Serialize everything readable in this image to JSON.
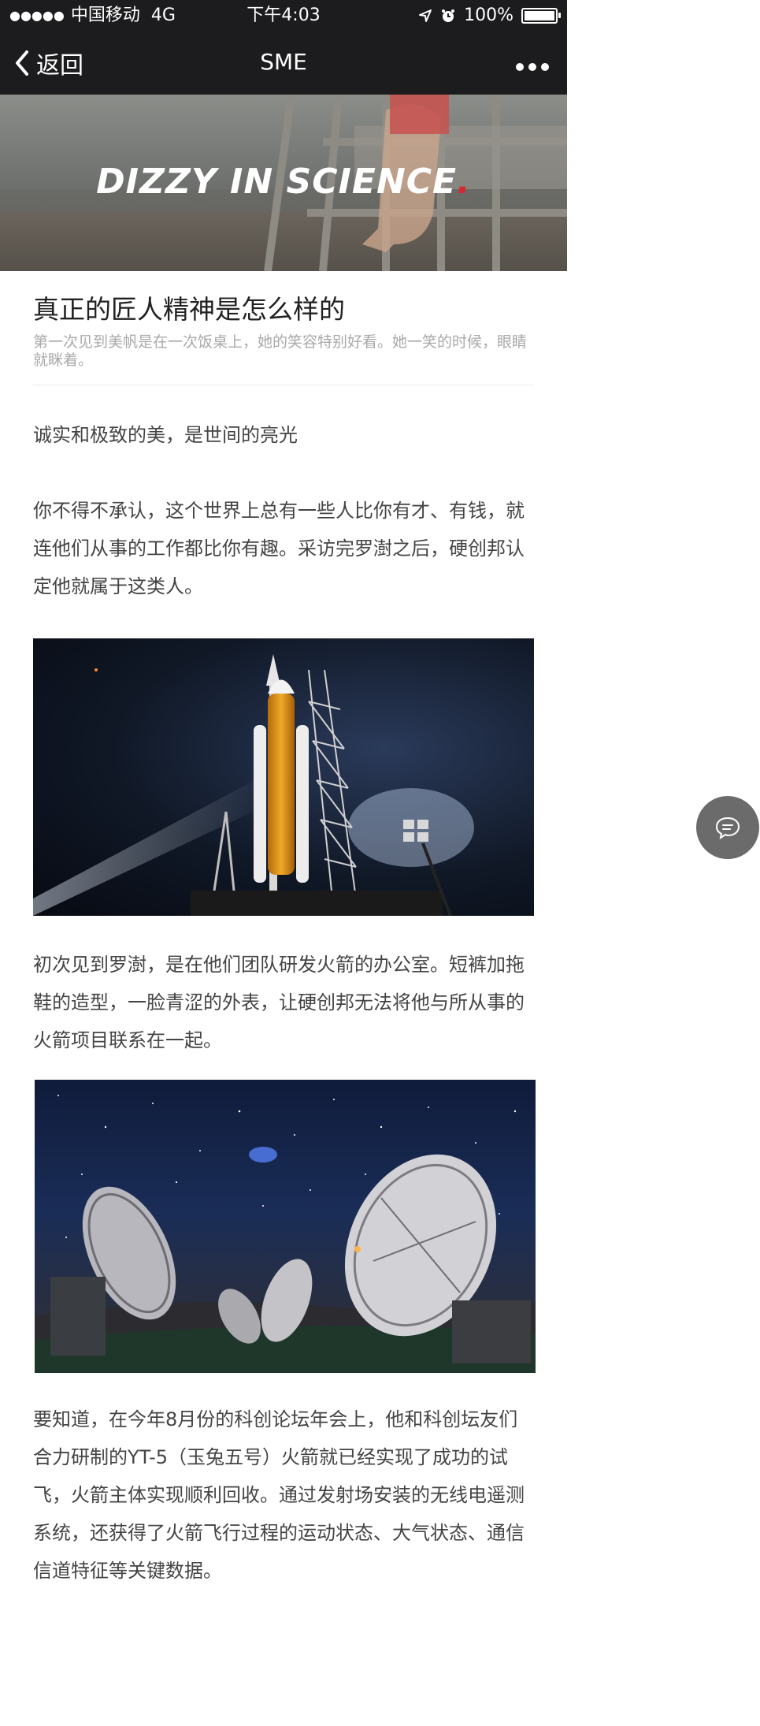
{
  "status_bar": {
    "signal": "●●●●●",
    "carrier": "中国移动",
    "network": "4G",
    "time": "下午4:03",
    "battery_pct": "100%",
    "battery_level": 1.0
  },
  "navbar": {
    "back_label": "返回",
    "title": "SME",
    "more_label": "•••"
  },
  "banner": {
    "text": "DIZZY IN SCIENCE",
    "dot": ".",
    "dot_color": "#d6282f"
  },
  "article": {
    "title": "真正的匠人精神是怎么样的",
    "subtitle": "第一次见到美帆是在一次饭桌上，她的笑容特别好看。她一笑的时候，眼睛就眯着。",
    "paragraphs": [
      "诚实和极致的美，是世间的亮光",
      "你不得不承认，这个世界上总有一些人比你有才、有钱，就连他们从事的工作都比你有趣。采访完罗澍之后，硬创邦认定他就属于这类人。",
      "初次见到罗澍，是在他们团队研发火箭的办公室。短裤加拖鞋的造型，一脸青涩的外表，让硬创邦无法将他与所从事的火箭项目联系在一起。",
      "要知道，在今年8月份的科创论坛年会上，他和科创坛友们合力研制的YT-5（玉兔五号）火箭就已经实现了成功的试飞，火箭主体实现顺利回收。通过发射场安装的无线电遥测系统，还获得了火箭飞行过程的运动状态、大气状态、通信信道特征等关键数据。"
    ]
  },
  "icons": {
    "back": "chevron-left-icon",
    "more": "more-dots-icon",
    "comment": "comment-icon",
    "location": "location-arrow-icon",
    "alarm": "alarm-clock-icon",
    "battery": "battery-icon"
  },
  "colors": {
    "bar_bg": "#1c1c1e",
    "text": "#444444",
    "subtitle": "#a9a9a9",
    "float_btn": "#6b6b6b"
  }
}
